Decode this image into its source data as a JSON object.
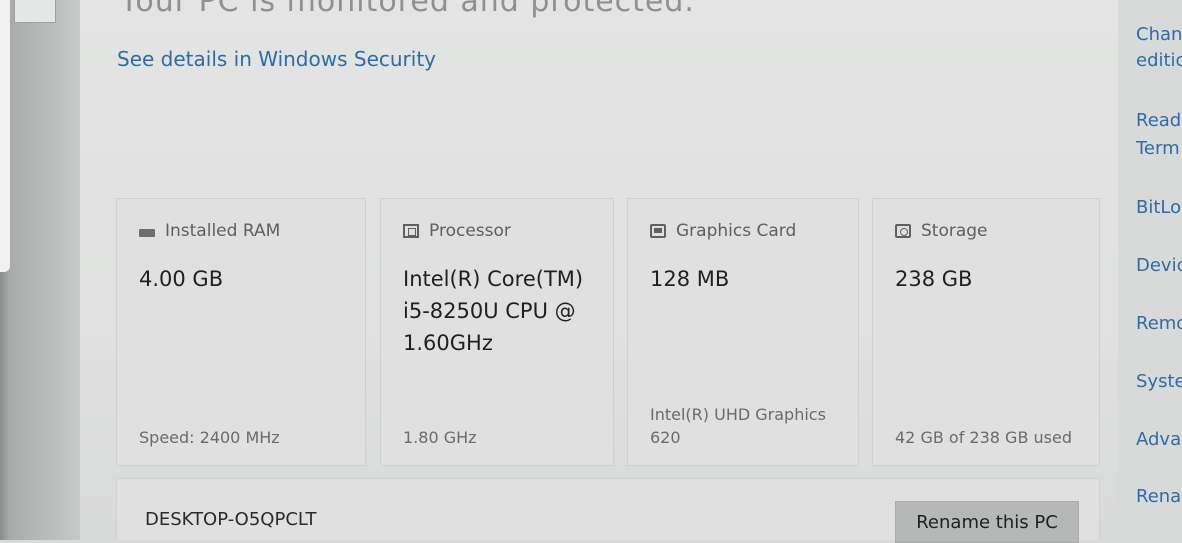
{
  "header": {
    "security_message": "Your PC is monitored and protected.",
    "security_link": "See details in Windows Security"
  },
  "specs": [
    {
      "icon": "ram-icon",
      "label": "Installed RAM",
      "value": "4.00 GB",
      "detail": "Speed: 2400 MHz"
    },
    {
      "icon": "processor-icon",
      "label": "Processor",
      "value": "Intel(R) Core(TM) i5-8250U CPU @ 1.60GHz",
      "detail": "1.80 GHz"
    },
    {
      "icon": "graphics-card-icon",
      "label": "Graphics Card",
      "value": "128 MB",
      "detail": "Intel(R) UHD Graphics 620"
    },
    {
      "icon": "storage-icon",
      "label": "Storage",
      "value": "238 GB",
      "detail": "42 GB of 238 GB used"
    }
  ],
  "device": {
    "name": "DESKTOP-O5QPCLT",
    "rename_label": "Rename this PC"
  },
  "related_links": [
    "Chan",
    "editic",
    "Read",
    "Term",
    "BitLo",
    "Devic",
    "Remo",
    "Syste",
    "Advar",
    "Renar"
  ]
}
